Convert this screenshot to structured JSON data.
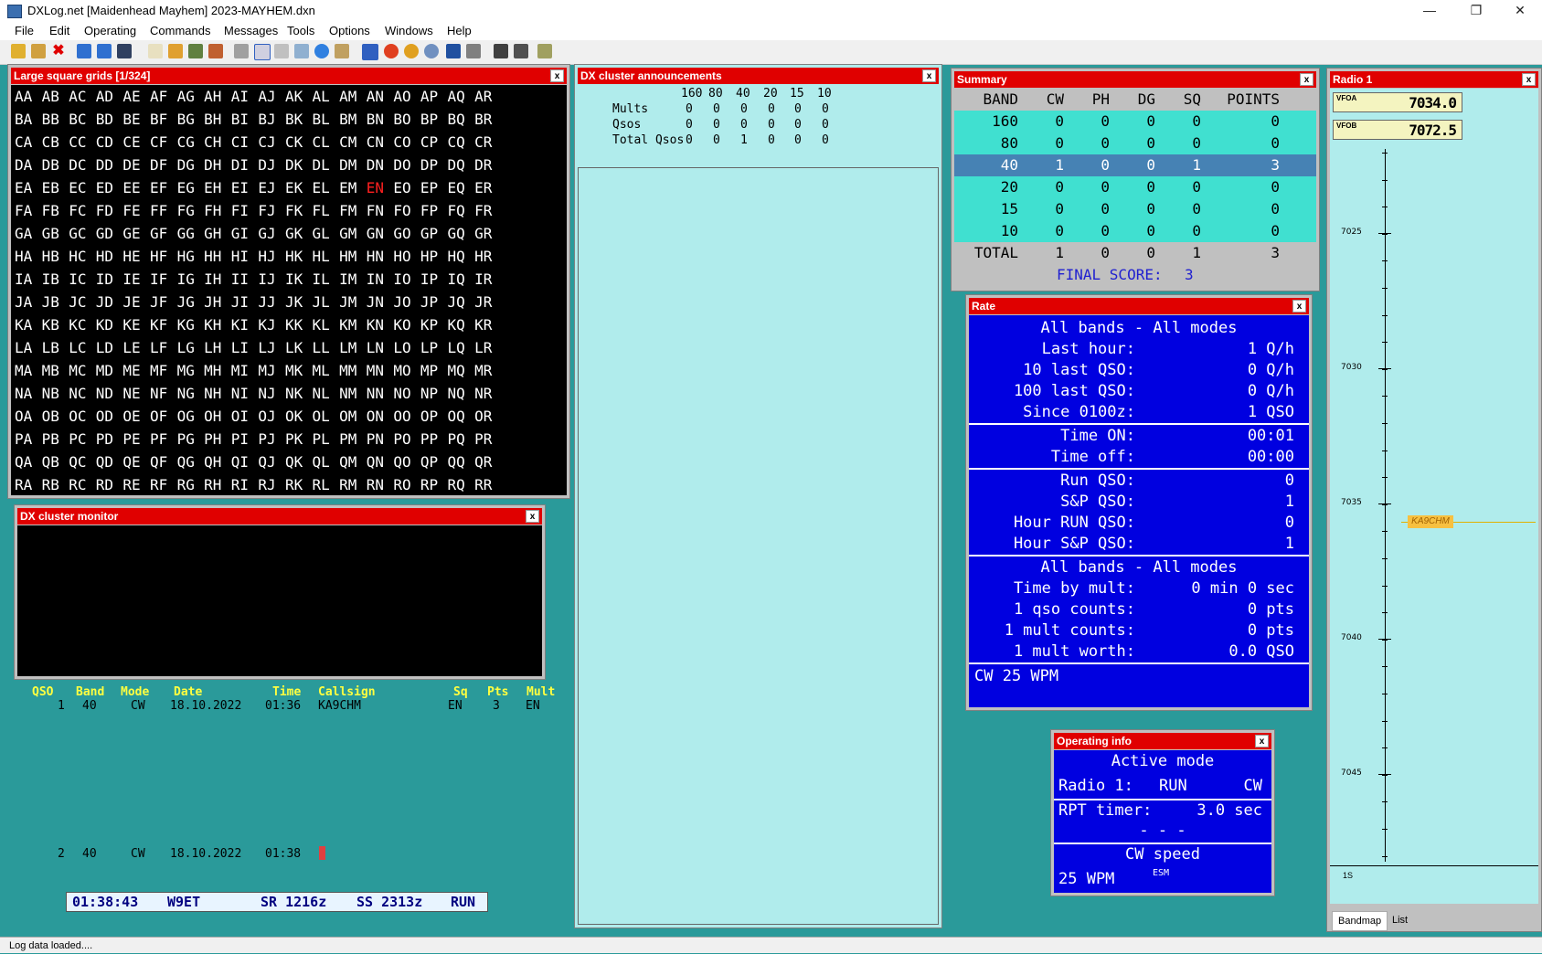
{
  "window": {
    "title": "DXLog.net [Maidenhead Mayhem] 2023-MAYHEM.dxn"
  },
  "menu": [
    "File",
    "Edit",
    "Operating",
    "Commands",
    "Messages",
    "Tools",
    "Options",
    "Windows",
    "Help"
  ],
  "grid_panel": {
    "title": "Large square grids [1/324]",
    "letters": "ABCDEFGHIJKLMNOPQR",
    "worked": [
      "EN"
    ]
  },
  "dx_monitor": {
    "title": "DX cluster monitor"
  },
  "announcements": {
    "title": "DX cluster announcements",
    "bands": [
      "160",
      "80",
      "40",
      "20",
      "15",
      "10"
    ],
    "rows": [
      {
        "label": "Mults",
        "values": [
          "0",
          "0",
          "0",
          "0",
          "0",
          "0"
        ]
      },
      {
        "label": "Qsos",
        "values": [
          "0",
          "0",
          "0",
          "0",
          "0",
          "0"
        ]
      },
      {
        "label": "Total Qsos",
        "values": [
          "0",
          "0",
          "1",
          "0",
          "0",
          "0"
        ]
      }
    ]
  },
  "summary": {
    "title": "Summary",
    "headers": [
      "BAND",
      "CW",
      "PH",
      "DG",
      "SQ",
      "POINTS"
    ],
    "rows": [
      [
        "160",
        "0",
        "0",
        "0",
        "0",
        "0"
      ],
      [
        "80",
        "0",
        "0",
        "0",
        "0",
        "0"
      ],
      [
        "40",
        "1",
        "0",
        "0",
        "1",
        "3"
      ],
      [
        "20",
        "0",
        "0",
        "0",
        "0",
        "0"
      ],
      [
        "15",
        "0",
        "0",
        "0",
        "0",
        "0"
      ],
      [
        "10",
        "0",
        "0",
        "0",
        "0",
        "0"
      ]
    ],
    "total": [
      "TOTAL",
      "1",
      "0",
      "0",
      "1",
      "3"
    ],
    "final_label": "FINAL SCORE:",
    "final_value": "3"
  },
  "rate": {
    "title": "Rate",
    "heading1": "All bands - All modes",
    "group1": [
      {
        "label": "Last hour:",
        "value": "1 Q/h"
      },
      {
        "label": "10 last QSO:",
        "value": "0 Q/h"
      },
      {
        "label": "100 last QSO:",
        "value": "0 Q/h"
      },
      {
        "label": "Since 0100z:",
        "value": "1 QSO"
      }
    ],
    "group2": [
      {
        "label": "Time ON:",
        "value": "00:01"
      },
      {
        "label": "Time off:",
        "value": "00:00"
      }
    ],
    "group3": [
      {
        "label": "Run QSO:",
        "value": "0"
      },
      {
        "label": "S&P QSO:",
        "value": "1"
      },
      {
        "label": "Hour RUN QSO:",
        "value": "0"
      },
      {
        "label": "Hour S&P QSO:",
        "value": "1"
      }
    ],
    "heading2": "All bands - All modes",
    "group4": [
      {
        "label": "Time by mult:",
        "value": "0 min 0 sec"
      },
      {
        "label": "1 qso counts:",
        "value": "0 pts"
      },
      {
        "label": "1 mult counts:",
        "value": "0 pts"
      },
      {
        "label": "1 mult worth:",
        "value": "0.0 QSO"
      }
    ],
    "footer": "CW 25 WPM"
  },
  "operating_info": {
    "title": "Operating info",
    "heading": "Active mode",
    "radio_label": "Radio 1:",
    "radio_mode": "RUN",
    "radio_op": "CW",
    "rpt_label": "RPT timer:",
    "rpt_value": "3.0 sec",
    "dashes": "- - -",
    "cw_heading": "CW speed",
    "cw_value": "25 WPM",
    "esm": "ESM"
  },
  "radio": {
    "title": "Radio 1",
    "vfoa_label": "VFOA",
    "vfoa_value": "7034.0",
    "vfob_label": "VFOB",
    "vfob_value": "7072.5",
    "scale_labels": [
      "7025",
      "7030",
      "7035",
      "7040",
      "7045"
    ],
    "spot_call": "KA9CHM",
    "bottom_label": "1S",
    "tabs": [
      "Bandmap",
      "List"
    ]
  },
  "log": {
    "headers": [
      "QSO",
      "Band",
      "Mode",
      "Date",
      "Time",
      "Callsign",
      "Sq",
      "Pts",
      "Mult"
    ],
    "entry": {
      "qso": "1",
      "band": "40",
      "mode": "CW",
      "date": "18.10.2022",
      "time": "01:36",
      "callsign": "KA9CHM",
      "sq": "EN",
      "pts": "3",
      "mult": "EN"
    },
    "new": {
      "qso": "2",
      "band": "40",
      "mode": "CW",
      "date": "18.10.2022",
      "time": "01:38"
    }
  },
  "status_line": {
    "time": "01:38:43",
    "call": "W9ET",
    "sr": "SR 1216z",
    "ss": "SS 2313z",
    "mode": "RUN"
  },
  "statusbar": {
    "text": "Log data loaded...."
  },
  "colors": {
    "panel_header": "#e00000",
    "rate_bg": "#0000e0",
    "summary_band": "#40e0d0",
    "summary_selected": "#4682b4",
    "workspace": "#2a9a9a"
  }
}
